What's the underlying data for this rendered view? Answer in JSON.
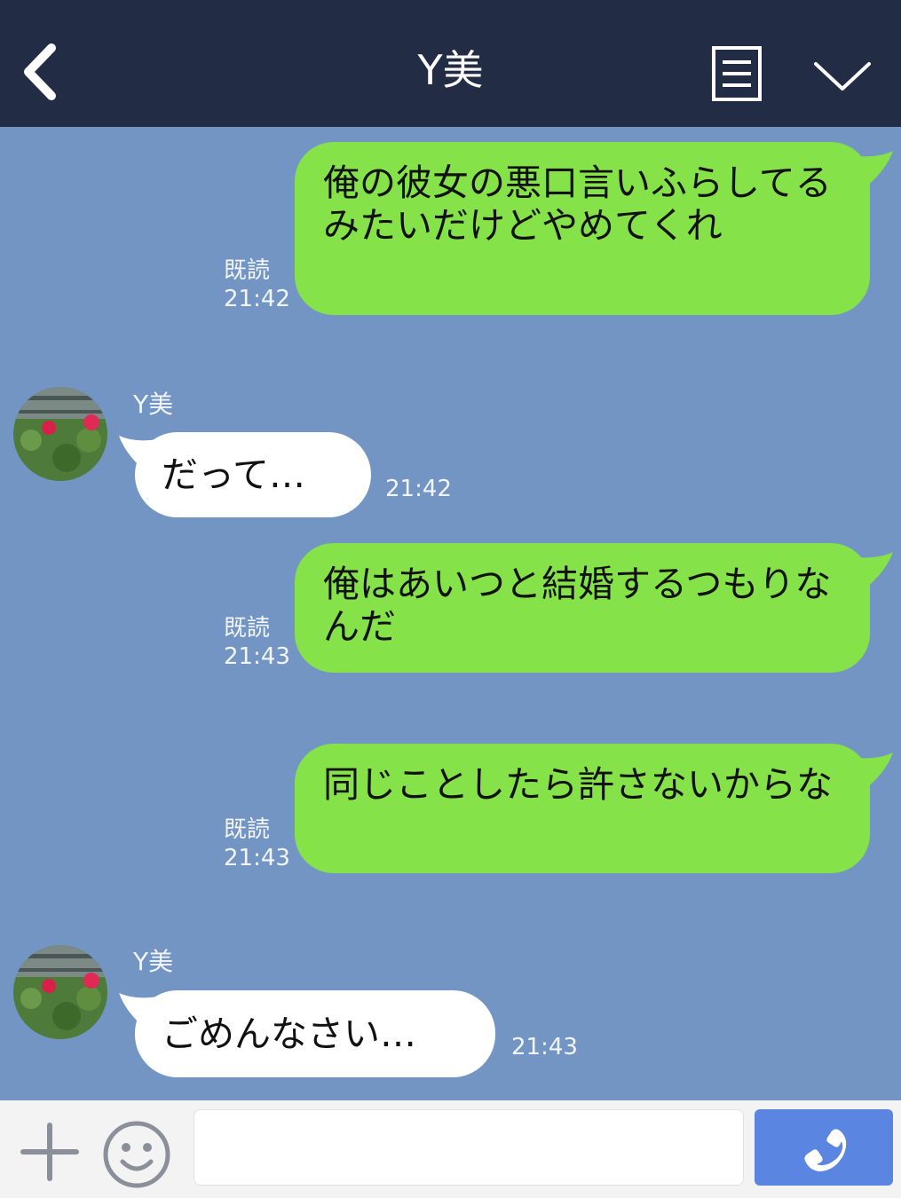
{
  "header": {
    "title": "Y美"
  },
  "messages": [
    {
      "side": "me",
      "text": "俺の彼女の悪口言いふらしてるみたいだけどやめてくれ",
      "read": "既読",
      "time": "21:42"
    },
    {
      "side": "you",
      "sender": "Y美",
      "text": "だって…",
      "time": "21:42"
    },
    {
      "side": "me",
      "text": "俺はあいつと結婚するつもりなんだ",
      "read": "既読",
      "time": "21:43"
    },
    {
      "side": "me",
      "text": "同じことしたら許さないからな",
      "read": "既読",
      "time": "21:43"
    },
    {
      "side": "you",
      "sender": "Y美",
      "text": "ごめんなさい…",
      "time": "21:43"
    }
  ],
  "input": {
    "value": "",
    "placeholder": ""
  },
  "colors": {
    "header_bg": "#222c45",
    "chat_bg": "#7395c4",
    "my_bubble": "#85e249",
    "their_bubble": "#ffffff",
    "send_button": "#5a86e2"
  },
  "icons": {
    "back": "chevron-left-icon",
    "notes": "notes-icon",
    "menu": "chevron-down-icon",
    "add": "plus-icon",
    "emoji": "smiley-icon",
    "call": "phone-icon"
  }
}
